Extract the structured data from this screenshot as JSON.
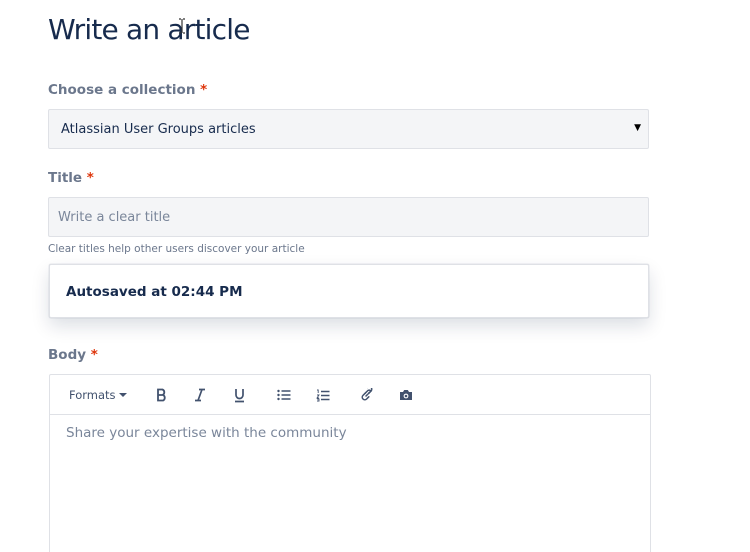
{
  "page": {
    "title_part1": "Write an a",
    "title_part2": "rticle"
  },
  "collection": {
    "label": "Choose a collection",
    "required_mark": "*",
    "selected": "Atlassian User Groups articles"
  },
  "title_field": {
    "label": "Title",
    "required_mark": "*",
    "placeholder": "Write a clear title",
    "help": "Clear titles help other users discover your article"
  },
  "autosave": {
    "message": "Autosaved at 02:44 PM"
  },
  "body_field": {
    "label": "Body",
    "required_mark": "*",
    "placeholder": "Share your expertise with the community"
  },
  "toolbar": {
    "formats_label": "Formats",
    "buttons": [
      "bold-icon",
      "italic-icon",
      "underline-icon",
      "bullet-list-icon",
      "numbered-list-icon",
      "link-icon",
      "camera-icon"
    ]
  },
  "colors": {
    "heading": "#172b4d",
    "label": "#6b778c",
    "required": "#de350b",
    "field_bg": "#f4f5f7",
    "border": "#dfe1e6"
  }
}
